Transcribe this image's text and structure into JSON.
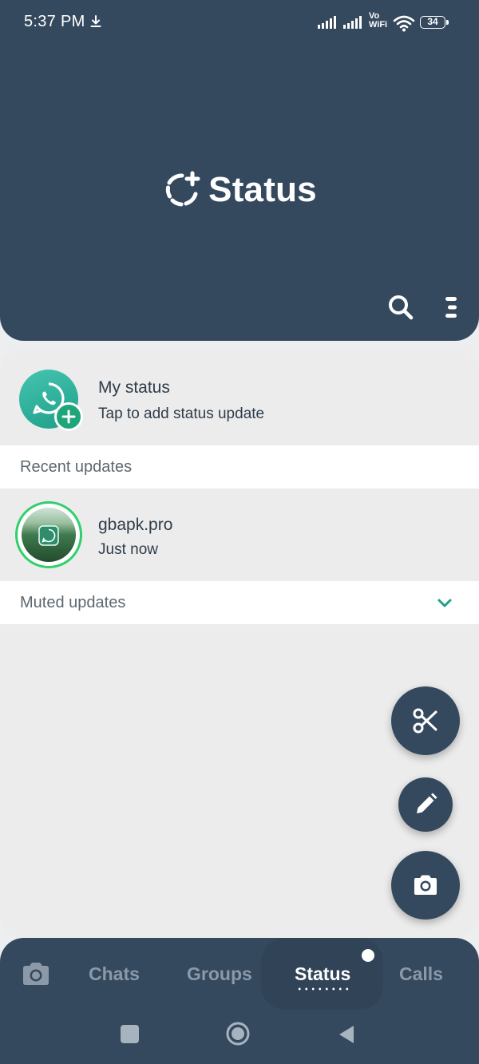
{
  "statusbar": {
    "time": "5:37 PM",
    "volte_top": "Vo",
    "volte_bottom": "WiFi",
    "battery": "34"
  },
  "header": {
    "title": "Status",
    "icons": [
      "status-add-icon",
      "search-icon",
      "menu-icon"
    ]
  },
  "my_status": {
    "title": "My status",
    "subtitle": "Tap to add status update"
  },
  "sections": {
    "recent": "Recent updates",
    "muted": "Muted updates"
  },
  "updates": [
    {
      "name": "gbapk.pro",
      "time": "Just now"
    }
  ],
  "fabs": [
    "scissors-icon",
    "pencil-icon",
    "camera-icon"
  ],
  "nav": {
    "tabs": [
      "Chats",
      "Groups",
      "Status",
      "Calls"
    ],
    "active": "Status"
  },
  "colors": {
    "primary": "#35495e",
    "accent_green": "#2fd06b",
    "badge_green": "#1fa57a",
    "teal_chevron": "#1fa08a"
  }
}
